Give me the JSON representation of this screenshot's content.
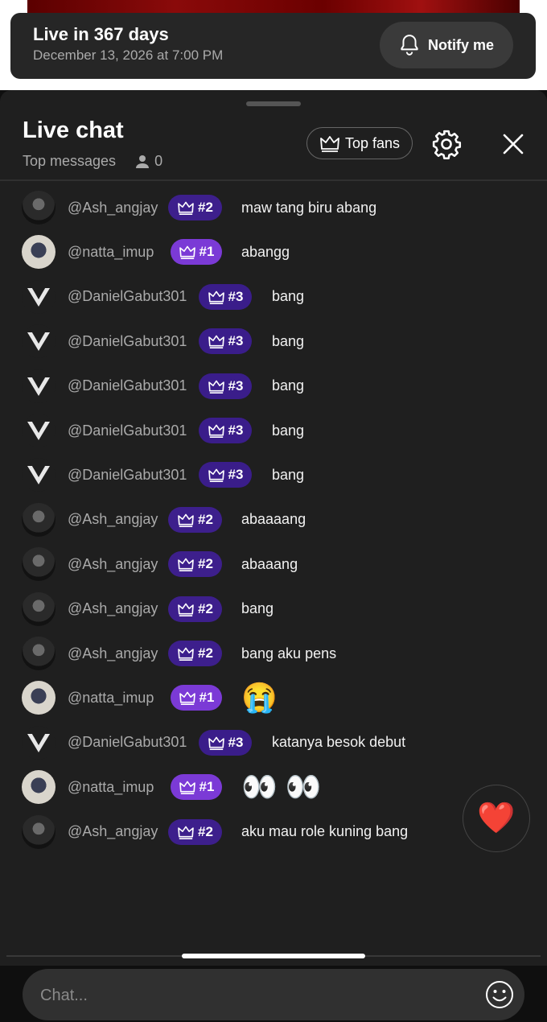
{
  "banner": {
    "title": "Live in 367 days",
    "date": "December 13, 2026 at 7:00 PM",
    "notify_label": "Notify me"
  },
  "chat_header": {
    "title": "Live chat",
    "subtitle": "Top messages",
    "viewer_count": "0",
    "top_fans_label": "Top fans"
  },
  "messages": [
    {
      "user": "@Ash_angjay",
      "avatar": "ash",
      "rank": "#2",
      "text": "maw tang biru abang"
    },
    {
      "user": "@natta_imup",
      "avatar": "natta",
      "rank": "#1",
      "text": "abangg"
    },
    {
      "user": "@DanielGabut301",
      "avatar": "daniel",
      "rank": "#3",
      "text": "bang"
    },
    {
      "user": "@DanielGabut301",
      "avatar": "daniel",
      "rank": "#3",
      "text": "bang"
    },
    {
      "user": "@DanielGabut301",
      "avatar": "daniel",
      "rank": "#3",
      "text": "bang"
    },
    {
      "user": "@DanielGabut301",
      "avatar": "daniel",
      "rank": "#3",
      "text": "bang"
    },
    {
      "user": "@DanielGabut301",
      "avatar": "daniel",
      "rank": "#3",
      "text": "bang"
    },
    {
      "user": "@Ash_angjay",
      "avatar": "ash",
      "rank": "#2",
      "text": "abaaaang"
    },
    {
      "user": "@Ash_angjay",
      "avatar": "ash",
      "rank": "#2",
      "text": "abaaang"
    },
    {
      "user": "@Ash_angjay",
      "avatar": "ash",
      "rank": "#2",
      "text": "bang"
    },
    {
      "user": "@Ash_angjay",
      "avatar": "ash",
      "rank": "#2",
      "text": "bang aku pens"
    },
    {
      "user": "@natta_imup",
      "avatar": "natta",
      "rank": "#1",
      "text": "😭"
    },
    {
      "user": "@DanielGabut301",
      "avatar": "daniel",
      "rank": "#3",
      "text": "katanya besok debut"
    },
    {
      "user": "@natta_imup",
      "avatar": "natta",
      "rank": "#1",
      "text": "👀 👀"
    },
    {
      "user": "@Ash_angjay",
      "avatar": "ash",
      "rank": "#2",
      "text": "aku mau role kuning bang"
    }
  ],
  "composer": {
    "placeholder": "Chat..."
  },
  "reaction": {
    "icon": "heart-icon"
  },
  "colors": {
    "rank1_badge": "#7b3ad6",
    "rank2_badge": "#3d1f8c",
    "rank3_badge": "#3a1d8a"
  }
}
